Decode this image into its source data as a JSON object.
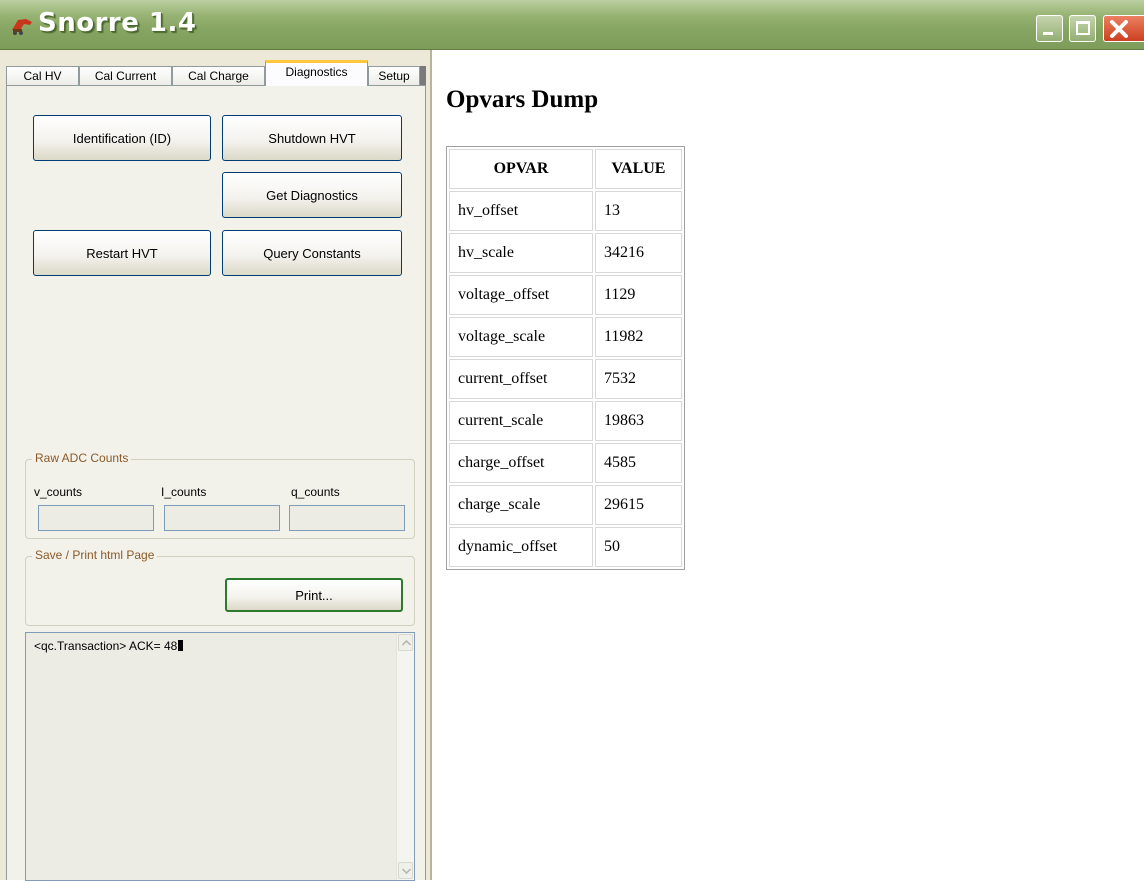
{
  "window": {
    "title": "Snorre 1.4",
    "icons": {
      "app": "app-logo-icon",
      "minimize": "minimize-icon",
      "maximize": "maximize-icon",
      "close": "close-icon"
    }
  },
  "tabs": [
    {
      "label": "Cal HV"
    },
    {
      "label": "Cal Current"
    },
    {
      "label": "Cal Charge"
    },
    {
      "label": "Diagnostics",
      "active": true
    },
    {
      "label": "Setup"
    }
  ],
  "diagnostics": {
    "buttons": {
      "identification": "Identification (ID)",
      "shutdown": "Shutdown HVT",
      "get_diagnostics": "Get Diagnostics",
      "restart": "Restart HVT",
      "query_constants": "Query Constants"
    },
    "raw_adc": {
      "legend": "Raw ADC Counts",
      "v_label": "v_counts",
      "i_label": "I_counts",
      "q_label": "q_counts",
      "v_value": "",
      "i_value": "",
      "q_value": ""
    },
    "save_print": {
      "legend": "Save / Print html Page",
      "print_button": "Print..."
    },
    "log": {
      "text": "<qc.Transaction> ACK= 48"
    }
  },
  "report": {
    "title": "Opvars Dump",
    "columns": [
      "OPVAR",
      "VALUE"
    ],
    "rows": [
      [
        "hv_offset",
        "13"
      ],
      [
        "hv_scale",
        "34216"
      ],
      [
        "voltage_offset",
        "1129"
      ],
      [
        "voltage_scale",
        "11982"
      ],
      [
        "current_offset",
        "7532"
      ],
      [
        "current_scale",
        "19863"
      ],
      [
        "charge_offset",
        "4585"
      ],
      [
        "charge_scale",
        "29615"
      ],
      [
        "dynamic_offset",
        "50"
      ]
    ]
  },
  "colors": {
    "titlebar": "#86a462",
    "panel": "#ece9d8",
    "active_tab_accent": "#ffc83c",
    "group_legend": "#8a5a2a"
  }
}
